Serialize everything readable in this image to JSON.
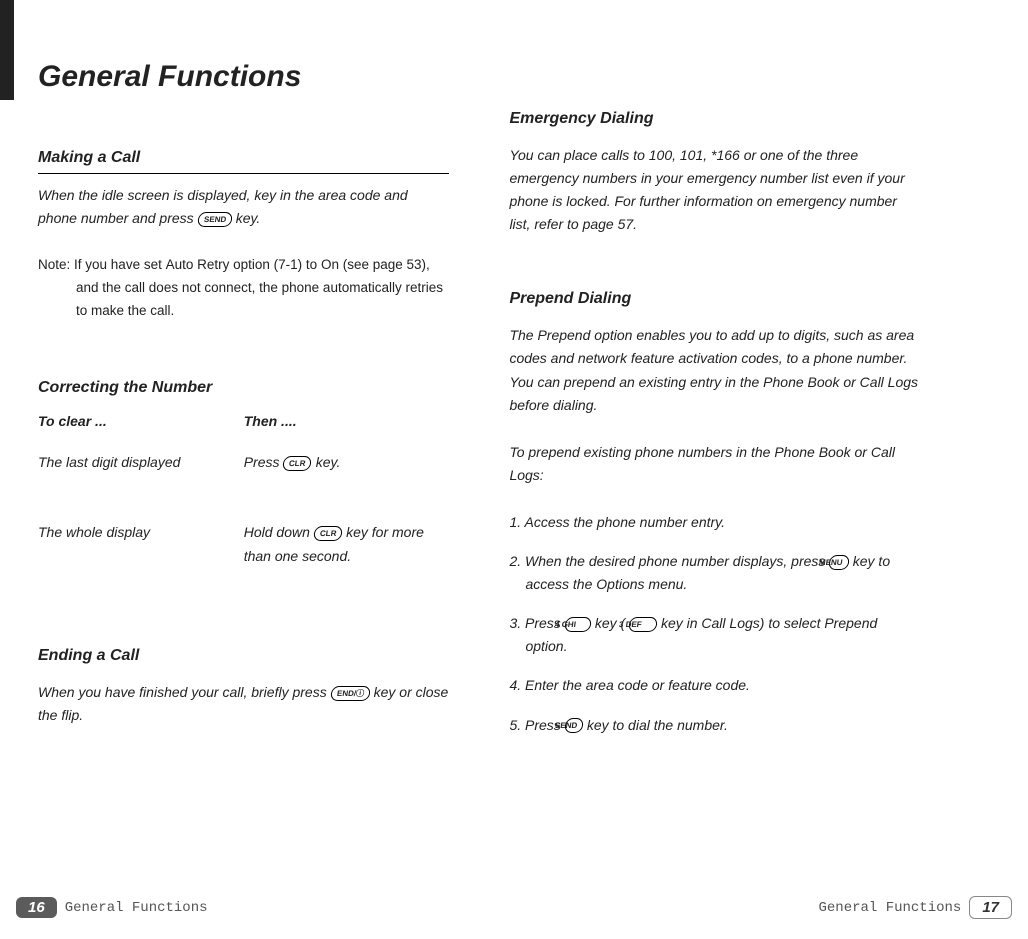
{
  "title": "General Functions",
  "left": {
    "h_making": "Making a Call",
    "p_making": "When the idle screen is displayed, key in the area code and phone number and press ",
    "p_making_end": " key.",
    "note_label": "Note",
    "note_body": ": If you have set ",
    "note_bold1": "Auto Retry",
    "note_mid1": " option (",
    "note_bold2": "7-1",
    "note_mid2": ") to ",
    "note_bold3": "On",
    "note_end": " (see page 53), and the call does not connect, the phone automatically retries to make the call.",
    "h_correct": "Correcting the Number",
    "table": {
      "th1": "To clear ...",
      "th2": "Then ....",
      "r1c1": "The last digit displayed",
      "r1c2a": "Press ",
      "r1c2b": " key.",
      "r2c1": "The whole display",
      "r2c2a": "Hold down ",
      "r2c2b": " key for more than one second."
    },
    "h_ending": "Ending a Call",
    "p_ending_a": "When you have finished your call, briefly press  ",
    "p_ending_b": " key or close the flip."
  },
  "right": {
    "h_emerg": "Emergency Dialing",
    "p_emerg": "You can place calls to 100, 101, *166 or one of the three emergency numbers in your emergency number list even if your phone is locked. For further information on emergency number list, refer to page 57.",
    "h_prepend": "Prepend Dialing",
    "p_prepend1a": "The ",
    "p_prepend1_bold": "Prepend",
    "p_prepend1b": " option enables you to add up to digits, such as area codes and network feature activation codes, to a phone number. You can prepend an existing entry in the Phone Book or Call Logs before dialing.",
    "p_prepend2": "To prepend existing phone numbers in the Phone Book or Call Logs:",
    "s1": "1. Access the phone number entry.",
    "s2a": "2. When the desired phone number displays, press ",
    "s2b": " key to access the ",
    "s2_bold": "Options",
    "s2c": " menu.",
    "s3a": "3. Press  ",
    "s3b": " key ( ",
    "s3c": " key in Call Logs)  to select ",
    "s3_bold": "Prepend",
    "s3d": " option.",
    "s4": "4. Enter the area code or feature code.",
    "s5a": "5. Press ",
    "s5b": " key to dial the number."
  },
  "keys": {
    "send": "SEND",
    "clr": "CLR",
    "end": "END/ⓘ",
    "menu": "MENU",
    "k4": "4 GHI",
    "k3": "3 DEF"
  },
  "footer": {
    "left_num": "16",
    "left_label": "General Functions",
    "right_label": "General Functions",
    "right_num": "17"
  }
}
